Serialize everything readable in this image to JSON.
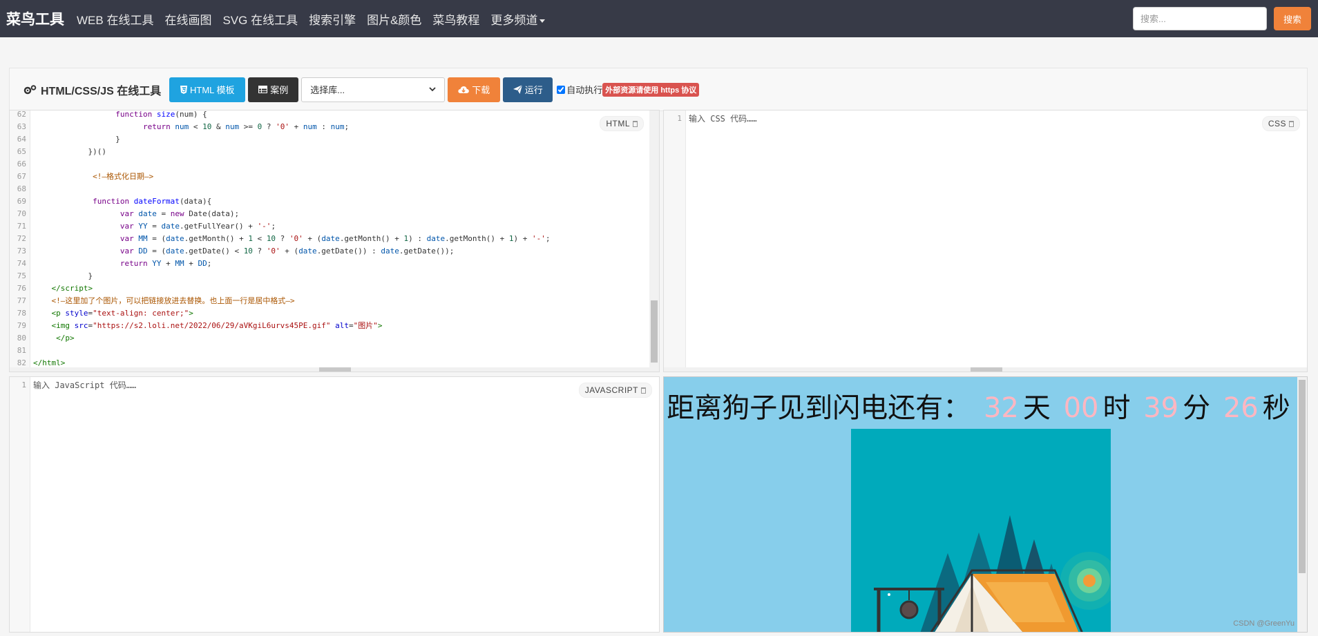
{
  "navbar": {
    "brand": "菜鸟工具",
    "items": [
      "WEB 在线工具",
      "在线画图",
      "SVG 在线工具",
      "搜索引擎",
      "图片&颜色",
      "菜鸟教程"
    ],
    "more": "更多频道",
    "search_placeholder": "搜索...",
    "search_button": "搜索"
  },
  "toolbar": {
    "title": "HTML/CSS/JS 在线工具",
    "html_template": "HTML 模板",
    "examples": "案例",
    "library_select": "选择库...",
    "download": "下载",
    "run": "运行",
    "auto_run": "自动执行",
    "https_note": "外部资源请使用 https 协议"
  },
  "html_editor": {
    "label": "HTML",
    "lines": [
      {
        "n": "62",
        "html": "                  <span class='kw'>function</span> <span class='fn'>size</span>(num) {"
      },
      {
        "n": "63",
        "html": "                        <span class='kw'>return</span> <span class='var'>num</span> &lt; <span class='num'>10</span> &amp; <span class='var'>num</span> &gt;= <span class='num'>0</span> ? <span class='str'>'0'</span> + <span class='var'>num</span> : <span class='var'>num</span>;"
      },
      {
        "n": "64",
        "html": "                  }"
      },
      {
        "n": "65",
        "html": "            })()"
      },
      {
        "n": "66",
        "html": ""
      },
      {
        "n": "67",
        "html": "             <span class='cm'>&lt;!—格式化日期—&gt;</span>"
      },
      {
        "n": "68",
        "html": ""
      },
      {
        "n": "69",
        "html": "             <span class='kw'>function</span> <span class='fn'>dateFormat</span>(data){"
      },
      {
        "n": "70",
        "html": "                   <span class='kw'>var</span> <span class='var'>date</span> = <span class='kw'>new</span> Date(data);"
      },
      {
        "n": "71",
        "html": "                   <span class='kw'>var</span> <span class='var'>YY</span> = <span class='var'>date</span>.getFullYear() + <span class='str'>'-'</span>;"
      },
      {
        "n": "72",
        "html": "                   <span class='kw'>var</span> <span class='var'>MM</span> = (<span class='var'>date</span>.getMonth() + <span class='num'>1</span> &lt; <span class='num'>10</span> ? <span class='str'>'0'</span> + (<span class='var'>date</span>.getMonth() + <span class='num'>1</span>) : <span class='var'>date</span>.getMonth() + <span class='num'>1</span>) + <span class='str'>'-'</span>;"
      },
      {
        "n": "73",
        "html": "                   <span class='kw'>var</span> <span class='var'>DD</span> = (<span class='var'>date</span>.getDate() &lt; <span class='num'>10</span> ? <span class='str'>'0'</span> + (<span class='var'>date</span>.getDate()) : <span class='var'>date</span>.getDate());"
      },
      {
        "n": "74",
        "html": "                   <span class='kw'>return</span> <span class='var'>YY</span> + <span class='var'>MM</span> + <span class='var'>DD</span>;"
      },
      {
        "n": "75",
        "html": "            }"
      },
      {
        "n": "76",
        "html": "    <span class='tag'>&lt;/script&gt;</span>"
      },
      {
        "n": "77",
        "html": "    <span class='cm'>&lt;!—这里加了个图片，可以把链接放进去替换。也上面一行是居中格式—&gt;</span>"
      },
      {
        "n": "78",
        "html": "    <span class='tag'>&lt;p</span> <span class='attr'>style</span>=<span class='str'>\"text-align: center;\"</span><span class='tag'>&gt;</span>"
      },
      {
        "n": "79",
        "html": "    <span class='tag'>&lt;img</span> <span class='attr'>src</span>=<span class='str'>\"https://s2.loli.net/2022/06/29/aVKgiL6urvs45PE.gif\"</span> <span class='attr'>alt</span>=<span class='str'>\"图片\"</span><span class='tag'>&gt;</span>"
      },
      {
        "n": "80",
        "html": "     <span class='tag'>&lt;/p&gt;</span>"
      },
      {
        "n": "81",
        "html": ""
      },
      {
        "n": "82",
        "html": "<span class='tag'>&lt;/html&gt;</span>"
      }
    ]
  },
  "css_editor": {
    "label": "CSS",
    "line": "1",
    "placeholder": "输入 CSS 代码……"
  },
  "js_editor": {
    "label": "JAVASCRIPT",
    "line": "1",
    "placeholder": "输入 JavaScript 代码……"
  },
  "preview": {
    "countdown_prefix": "距离狗子见到闪电还有：",
    "days": "32",
    "days_unit": "天",
    "hours": "00",
    "hours_unit": "时",
    "minutes": "39",
    "minutes_unit": "分",
    "seconds": "26",
    "seconds_unit": "秒",
    "watermark": "CSDN @GreenYu"
  },
  "colors": {
    "navbar_bg": "#373a47",
    "accent_orange": "#f0823a",
    "accent_blue": "#1fa3e0",
    "run_navy": "#2d5d8a",
    "preview_bg": "#87ceeb",
    "countdown_number": "#ffb6c1"
  },
  "icons": [
    "gears-icon",
    "html5-icon",
    "table-icon",
    "cloud-download-icon",
    "send-icon",
    "trash-icon",
    "chevron-down-icon"
  ]
}
